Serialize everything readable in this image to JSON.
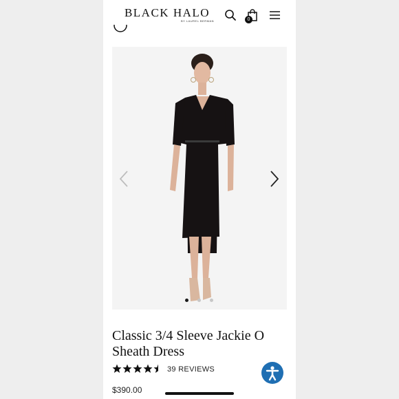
{
  "header": {
    "logo_text": "BLACK HALO",
    "logo_subtext": "BY LAUREL BERMAN",
    "cart_count": "0",
    "icons": [
      "search-icon",
      "shopping-bag-icon",
      "menu-icon"
    ]
  },
  "gallery": {
    "image_count": 3,
    "active_index": 0,
    "icons": [
      "chevron-left-icon",
      "chevron-right-icon"
    ]
  },
  "product": {
    "title": "Classic 3/4 Sleeve Jackie O Sheath Dress",
    "rating_stars": 4.5,
    "reviews_label": "39 REVIEWS",
    "price": "$390.00"
  },
  "accessibility": {
    "icon": "accessibility-icon",
    "color": "#1f6fb3"
  }
}
